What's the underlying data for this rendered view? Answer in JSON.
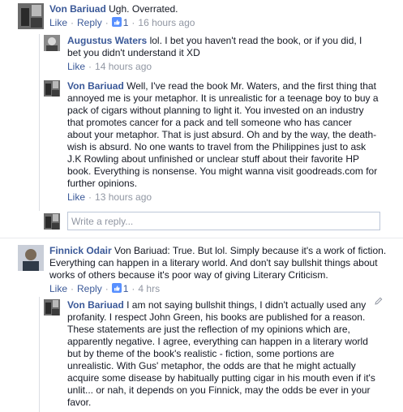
{
  "comments": [
    {
      "author": "Von Bariuad",
      "text": "Ugh. Overrated.",
      "like": "Like",
      "reply": "Reply",
      "likes": "1",
      "time": "16 hours ago"
    },
    {
      "author": "Augustus Waters",
      "text": "lol. I bet you haven't read the book, or if you did, I bet you didn't understand it XD",
      "like": "Like",
      "time": "14 hours ago"
    },
    {
      "author": "Von Bariuad",
      "text": "Well, I've read the book Mr. Waters, and the first thing that annoyed me is your metaphor. It is unrealistic for a teenage boy to buy a pack of cigars without planning to light it. You invested on an industry that promotes cancer for a pack and tell someone who has cancer about your metaphor. That is just absurd. Oh and by the way, the death-wish is absurd. No one wants to travel from the Philippines just to ask J.K Rowling about unfinished or unclear stuff about their favorite HP book. Everything is nonsense. You might wanna visit goodreads.com for further opinions.",
      "like": "Like",
      "time": "13 hours ago"
    },
    {
      "author": "Finnick Odair",
      "text": "Von Bariuad: True. But lol. Simply because it's a work of fiction. Everything can happen in a literary world. And don't say bullshit things about works of others because it's poor way of giving Literary Criticism.",
      "like": "Like",
      "reply": "Reply",
      "likes": "1",
      "time": "4 hrs"
    },
    {
      "author": "Von Bariuad",
      "text": "I am not saying bullshit things, I didn't actually used any profanity. I respect John Green, his books are published for a reason. These statements are just the reflection of my opinions which are, apparently negative. I agree, everything can happen in a literary world but by theme of the book's realistic - fiction, some portions are unrealistic. With Gus' metaphor, the odds are that he might actually acquire some disease by habitually putting cigar in his mouth even if it's unlit... or nah, it depends on you Finnick, may the odds be ever in your favor."
    }
  ],
  "reply_box": {
    "placeholder": "Write a reply..."
  },
  "icons": {
    "like": "thumbs-up-icon",
    "edit": "pencil-icon"
  },
  "colors": {
    "name_link": "#3b5998",
    "meta": "#9197a3",
    "thumb": "#5890ff"
  }
}
